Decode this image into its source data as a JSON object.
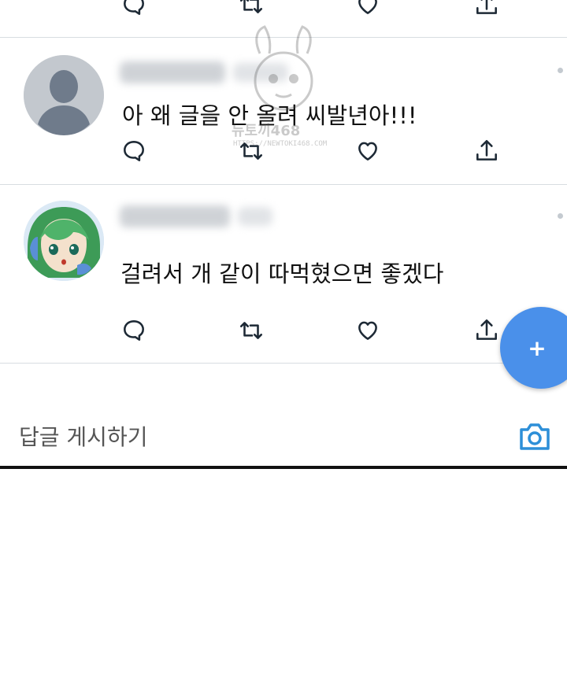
{
  "tweets": [
    {
      "text": "아 왜 글을 안 올려 씨발년아!!!",
      "avatar": "default-user-silhouette",
      "handle_blurred": true
    },
    {
      "text": "걸려서 개 같이 따먹혔으면 좋겠다",
      "avatar": "green-haired-cartoon-character",
      "handle_blurred": true
    }
  ],
  "actions": {
    "reply_icon": "reply-icon",
    "retweet_icon": "retweet-icon",
    "like_icon": "heart-icon",
    "share_icon": "share-icon"
  },
  "fab": {
    "label": "+"
  },
  "reply_bar": {
    "placeholder": "답글 게시하기",
    "camera_icon": "camera-icon"
  },
  "watermark": {
    "text": "HTTPS://NEWTOKI468.COM",
    "brand_text": "뉴토끼468"
  },
  "colors": {
    "accent": "#4a90ea",
    "icon": "#1d2935",
    "divider": "#d8dde1"
  }
}
